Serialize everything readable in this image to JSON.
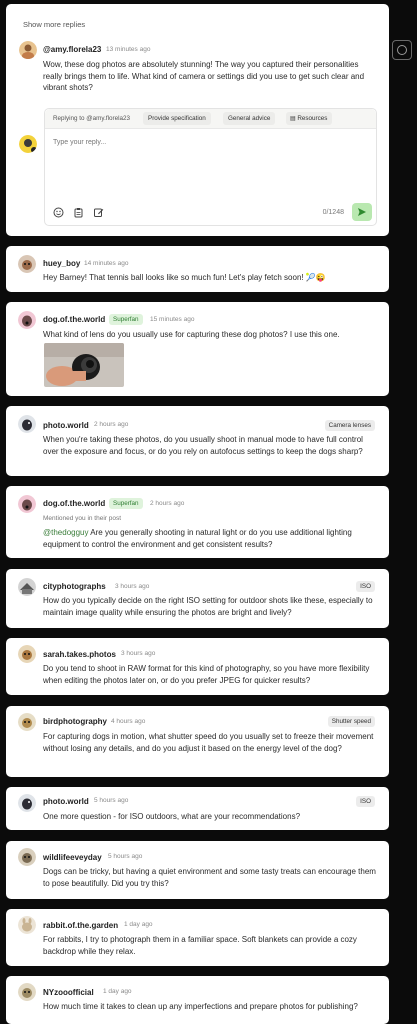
{
  "thread": {
    "show_more": "Show more replies",
    "top": {
      "username": "@amy.florela23",
      "time": "13 minutes ago",
      "text": "Wow, these dog photos are absolutely stunning! The way you captured their personalities really brings them to life. What kind of camera or settings did you use to get such clear and vibrant shots?"
    },
    "reply": {
      "replying_to": "Replying to @amy.florela23",
      "provide_spec": "Provide specification",
      "general_advice": "General advice",
      "resources": "Resources",
      "placeholder": "Type your reply...",
      "counter": "0/1248"
    }
  },
  "comments": [
    {
      "username": "huey_boy",
      "time": "14 minutes ago",
      "text": "Hey Barney! That tennis ball looks like so much fun! Let's play fetch soon! 🎾😜"
    },
    {
      "username": "dog.of.the.world",
      "badge": "Superfan",
      "time": "15 minutes ago",
      "text": "What kind of lens do you usually use for capturing these dog photos? I use this one."
    },
    {
      "username": "photo.world",
      "time": "2 hours ago",
      "tag": "Camera lenses",
      "text": "When you're taking these photos, do you usually shoot in manual mode to have full control over the exposure and focus, or do you rely on autofocus settings to keep the dogs sharp?"
    },
    {
      "username": "dog.of.the.world",
      "badge": "Superfan",
      "time": "2 hours ago",
      "mentioned": "Mentioned you in their post",
      "mention": "@thedogguy",
      "text": " Are you generally shooting in natural light or do you use additional lighting equipment to control the environment and get consistent results?"
    },
    {
      "username": "cityphotographs",
      "time": "3 hours ago",
      "tag": "ISO",
      "text": "How do you typically decide on the right ISO setting for outdoor shots like these, especially to maintain image quality while ensuring the photos are bright and lively?"
    },
    {
      "username": "sarah.takes.photos",
      "time": "3 hours ago",
      "text": "Do you tend to shoot in RAW format for this kind of photography, so you have more flexibility when editing the photos later on, or do you prefer JPEG for quicker results?"
    },
    {
      "username": "birdphotography",
      "time": "4 hours ago",
      "tag": "Shutter speed",
      "text": "For capturing dogs in motion, what shutter speed do you usually set to freeze their movement without losing any details, and do you adjust it based on the energy level of the dog?"
    },
    {
      "username": "photo.world",
      "time": "5 hours ago",
      "tag": "ISO",
      "text": "One more question - for ISO outdoors, what are your recommendations?"
    },
    {
      "username": "wildlifeeveyday",
      "time": "5 hours ago",
      "text": "Dogs can be tricky, but having a quiet environment and some tasty treats can encourage them to pose beautifully. Did you try this?"
    },
    {
      "username": "rabbit.of.the.garden",
      "time": "1 day ago",
      "text": "For rabbits, I try to photograph them in a familiar space. Soft blankets can provide a cozy backdrop while they relax."
    },
    {
      "username": "NYzooofficial",
      "time": "1 day ago",
      "text": "How much time it takes to clean up any imperfections and prepare photos for publishing?"
    }
  ],
  "icons": [
    "emoji-icon",
    "clipboard-icon",
    "edit-icon",
    "send-icon",
    "resources-icon",
    "history-icon"
  ],
  "colors": {
    "accent_green": "#b9e8b0",
    "superfan_text": "#2e7d32",
    "mention": "#3a7d3a"
  }
}
